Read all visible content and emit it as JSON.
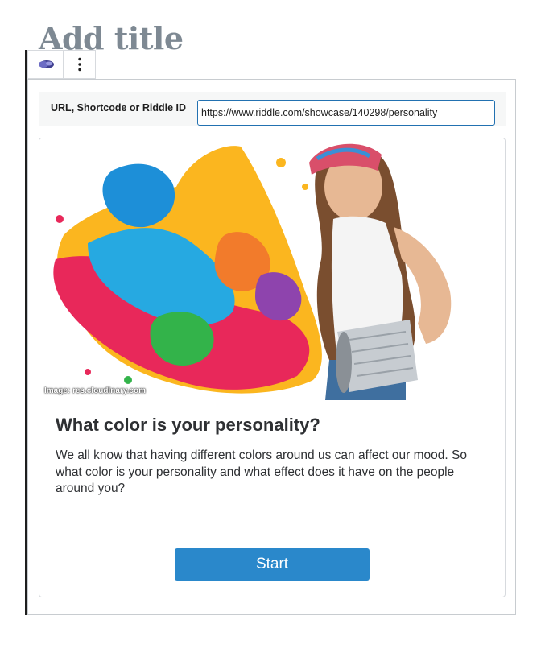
{
  "page": {
    "title": "Add title"
  },
  "toolbar": {
    "block_icon": "riddle-icon",
    "more_icon": "more-vertical-icon"
  },
  "embed": {
    "url_label": "URL, Shortcode or Riddle ID",
    "url_value": "https://www.riddle.com/showcase/140298/personality"
  },
  "quiz": {
    "image_credit": "Image: res.cloudinary.com",
    "title": "What color is your personality?",
    "description": "We all know that having different colors around us can affect our mood. So what color is your personality and what effect does it have on the people around you?",
    "start_label": "Start"
  },
  "colors": {
    "accent": "#2a88cb",
    "input_border": "#2271b1",
    "title_gray": "#7e8993"
  }
}
